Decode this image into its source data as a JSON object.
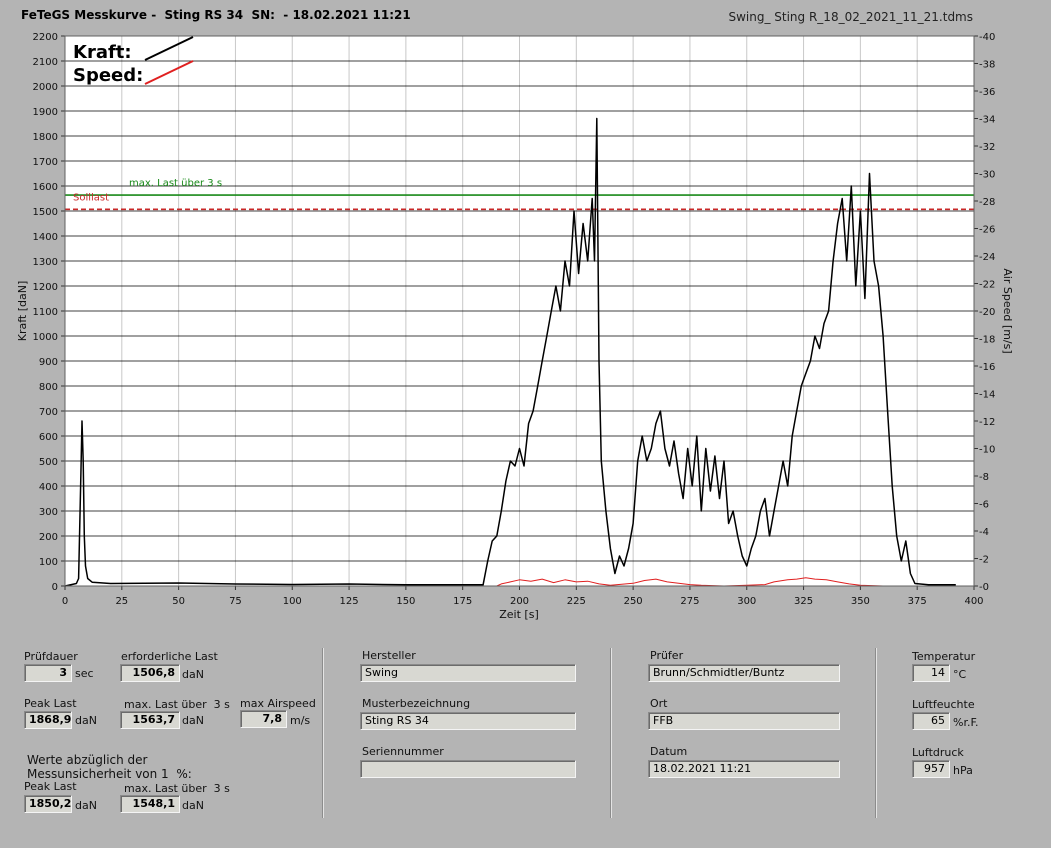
{
  "header": {
    "title": "FeTeGS Messkurve -  Sting RS 34  SN:  - 18.02.2021 11:21",
    "filename": "Swing_ Sting R_18_02_2021_11_21.tdms"
  },
  "chart_data": {
    "type": "line",
    "xlabel": "Zeit [s]",
    "ylabel": "Kraft [daN]",
    "y2label": "Air Speed [m/s]",
    "xlim": [
      0,
      400
    ],
    "ylim": [
      0,
      2200
    ],
    "y2lim": [
      0,
      40
    ],
    "x_ticks": [
      0,
      25,
      50,
      75,
      100,
      125,
      150,
      175,
      200,
      225,
      250,
      275,
      300,
      325,
      350,
      375,
      400
    ],
    "y_ticks": [
      0,
      100,
      200,
      300,
      400,
      500,
      600,
      700,
      800,
      900,
      1000,
      1100,
      1200,
      1300,
      1400,
      1500,
      1600,
      1700,
      1800,
      1900,
      2000,
      2100,
      2200
    ],
    "y2_ticks": [
      0,
      2,
      4,
      6,
      8,
      10,
      12,
      14,
      16,
      18,
      20,
      22,
      24,
      26,
      28,
      30,
      32,
      34,
      36,
      38,
      40
    ],
    "grid": true,
    "legend": {
      "position": "top-left",
      "entries": [
        {
          "name": "Kraft:",
          "color": "#000000"
        },
        {
          "name": "Speed:",
          "color": "#e02020"
        }
      ]
    },
    "reference_lines": [
      {
        "label": "max. Last über  3 s",
        "value": 1563.7,
        "color": "#1a8a1a",
        "style": "solid"
      },
      {
        "label": "Solllast",
        "value": 1506.8,
        "color": "#c82828",
        "style": "dashed"
      }
    ],
    "series": [
      {
        "name": "Kraft:",
        "axis": "left",
        "color": "#000000",
        "points": [
          [
            0,
            0
          ],
          [
            5,
            10
          ],
          [
            6,
            30
          ],
          [
            7,
            450
          ],
          [
            7.5,
            660
          ],
          [
            8,
            500
          ],
          [
            8.5,
            200
          ],
          [
            9,
            80
          ],
          [
            10,
            30
          ],
          [
            12,
            15
          ],
          [
            20,
            10
          ],
          [
            50,
            12
          ],
          [
            75,
            8
          ],
          [
            100,
            6
          ],
          [
            125,
            8
          ],
          [
            150,
            5
          ],
          [
            175,
            5
          ],
          [
            184,
            5
          ],
          [
            186,
            100
          ],
          [
            188,
            180
          ],
          [
            190,
            200
          ],
          [
            192,
            300
          ],
          [
            194,
            420
          ],
          [
            196,
            500
          ],
          [
            198,
            480
          ],
          [
            200,
            550
          ],
          [
            202,
            480
          ],
          [
            204,
            650
          ],
          [
            206,
            700
          ],
          [
            208,
            800
          ],
          [
            210,
            900
          ],
          [
            212,
            1000
          ],
          [
            214,
            1100
          ],
          [
            216,
            1200
          ],
          [
            218,
            1100
          ],
          [
            220,
            1300
          ],
          [
            222,
            1200
          ],
          [
            224,
            1500
          ],
          [
            226,
            1250
          ],
          [
            228,
            1450
          ],
          [
            230,
            1300
          ],
          [
            232,
            1550
          ],
          [
            233,
            1300
          ],
          [
            234,
            1870
          ],
          [
            235,
            900
          ],
          [
            236,
            500
          ],
          [
            238,
            300
          ],
          [
            240,
            150
          ],
          [
            242,
            50
          ],
          [
            244,
            120
          ],
          [
            246,
            80
          ],
          [
            248,
            150
          ],
          [
            250,
            250
          ],
          [
            252,
            500
          ],
          [
            254,
            600
          ],
          [
            256,
            500
          ],
          [
            258,
            550
          ],
          [
            260,
            650
          ],
          [
            262,
            700
          ],
          [
            264,
            550
          ],
          [
            266,
            480
          ],
          [
            268,
            580
          ],
          [
            270,
            450
          ],
          [
            272,
            350
          ],
          [
            274,
            550
          ],
          [
            276,
            400
          ],
          [
            278,
            600
          ],
          [
            280,
            300
          ],
          [
            282,
            550
          ],
          [
            284,
            380
          ],
          [
            286,
            520
          ],
          [
            288,
            350
          ],
          [
            290,
            500
          ],
          [
            292,
            250
          ],
          [
            294,
            300
          ],
          [
            296,
            200
          ],
          [
            298,
            120
          ],
          [
            300,
            80
          ],
          [
            302,
            150
          ],
          [
            304,
            200
          ],
          [
            306,
            300
          ],
          [
            308,
            350
          ],
          [
            310,
            200
          ],
          [
            312,
            300
          ],
          [
            314,
            400
          ],
          [
            316,
            500
          ],
          [
            318,
            400
          ],
          [
            320,
            600
          ],
          [
            322,
            700
          ],
          [
            324,
            800
          ],
          [
            326,
            850
          ],
          [
            328,
            900
          ],
          [
            330,
            1000
          ],
          [
            332,
            950
          ],
          [
            334,
            1050
          ],
          [
            336,
            1100
          ],
          [
            338,
            1300
          ],
          [
            340,
            1450
          ],
          [
            342,
            1550
          ],
          [
            344,
            1300
          ],
          [
            346,
            1600
          ],
          [
            348,
            1200
          ],
          [
            350,
            1500
          ],
          [
            352,
            1150
          ],
          [
            354,
            1650
          ],
          [
            356,
            1300
          ],
          [
            358,
            1200
          ],
          [
            360,
            1000
          ],
          [
            362,
            700
          ],
          [
            364,
            400
          ],
          [
            366,
            200
          ],
          [
            368,
            100
          ],
          [
            370,
            180
          ],
          [
            372,
            50
          ],
          [
            374,
            10
          ],
          [
            380,
            5
          ],
          [
            392,
            5
          ]
        ]
      },
      {
        "name": "Speed:",
        "axis": "right",
        "color": "#e02020",
        "points": [
          [
            0,
            0
          ],
          [
            190,
            0
          ],
          [
            192,
            0.15
          ],
          [
            196,
            0.3
          ],
          [
            200,
            0.45
          ],
          [
            205,
            0.35
          ],
          [
            210,
            0.5
          ],
          [
            215,
            0.25
          ],
          [
            220,
            0.45
          ],
          [
            225,
            0.3
          ],
          [
            230,
            0.35
          ],
          [
            235,
            0.15
          ],
          [
            240,
            0.05
          ],
          [
            250,
            0.2
          ],
          [
            255,
            0.4
          ],
          [
            260,
            0.5
          ],
          [
            265,
            0.3
          ],
          [
            270,
            0.2
          ],
          [
            275,
            0.1
          ],
          [
            280,
            0.05
          ],
          [
            290,
            0
          ],
          [
            300,
            0.05
          ],
          [
            308,
            0.1
          ],
          [
            312,
            0.3
          ],
          [
            318,
            0.45
          ],
          [
            322,
            0.5
          ],
          [
            326,
            0.6
          ],
          [
            330,
            0.5
          ],
          [
            335,
            0.45
          ],
          [
            340,
            0.3
          ],
          [
            345,
            0.15
          ],
          [
            350,
            0.05
          ],
          [
            360,
            0
          ],
          [
            392,
            0
          ]
        ]
      }
    ]
  },
  "panel": {
    "pruefdauer": {
      "label": "Prüfdauer",
      "value": "3",
      "unit": "sec"
    },
    "erforderliche_last": {
      "label": "erforderliche Last",
      "value": "1506,8",
      "unit": "daN"
    },
    "peak_last": {
      "label": "Peak Last",
      "value": "1868,9",
      "unit": "daN"
    },
    "max_last": {
      "label": "max. Last über  3 s",
      "value": "1563,7",
      "unit": "daN"
    },
    "max_airspeed": {
      "label": "max Airspeed",
      "value": "7,8",
      "unit": "m/s"
    },
    "note_line1": "Werte abzüglich der",
    "note_line2": "Messunsicherheit von 1  %:",
    "peak_last_corr": {
      "label": "Peak Last",
      "value": "1850,2",
      "unit": "daN"
    },
    "max_last_corr": {
      "label": "max. Last über  3 s",
      "value": "1548,1",
      "unit": "daN"
    },
    "hersteller": {
      "label": "Hersteller",
      "value": "Swing"
    },
    "musterbezeichnung": {
      "label": "Musterbezeichnung",
      "value": "Sting RS 34"
    },
    "seriennummer": {
      "label": "Seriennummer",
      "value": ""
    },
    "pruefer": {
      "label": "Prüfer",
      "value": "Brunn/Schmidtler/Buntz"
    },
    "ort": {
      "label": "Ort",
      "value": "FFB"
    },
    "datum": {
      "label": "Datum",
      "value": "18.02.2021 11:21"
    },
    "temperatur": {
      "label": "Temperatur",
      "value": "14",
      "unit": "°C"
    },
    "luftfeuchte": {
      "label": "Luftfeuchte",
      "value": "65",
      "unit": "%r.F."
    },
    "luftdruck": {
      "label": "Luftdruck",
      "value": "957",
      "unit": "hPa"
    }
  }
}
